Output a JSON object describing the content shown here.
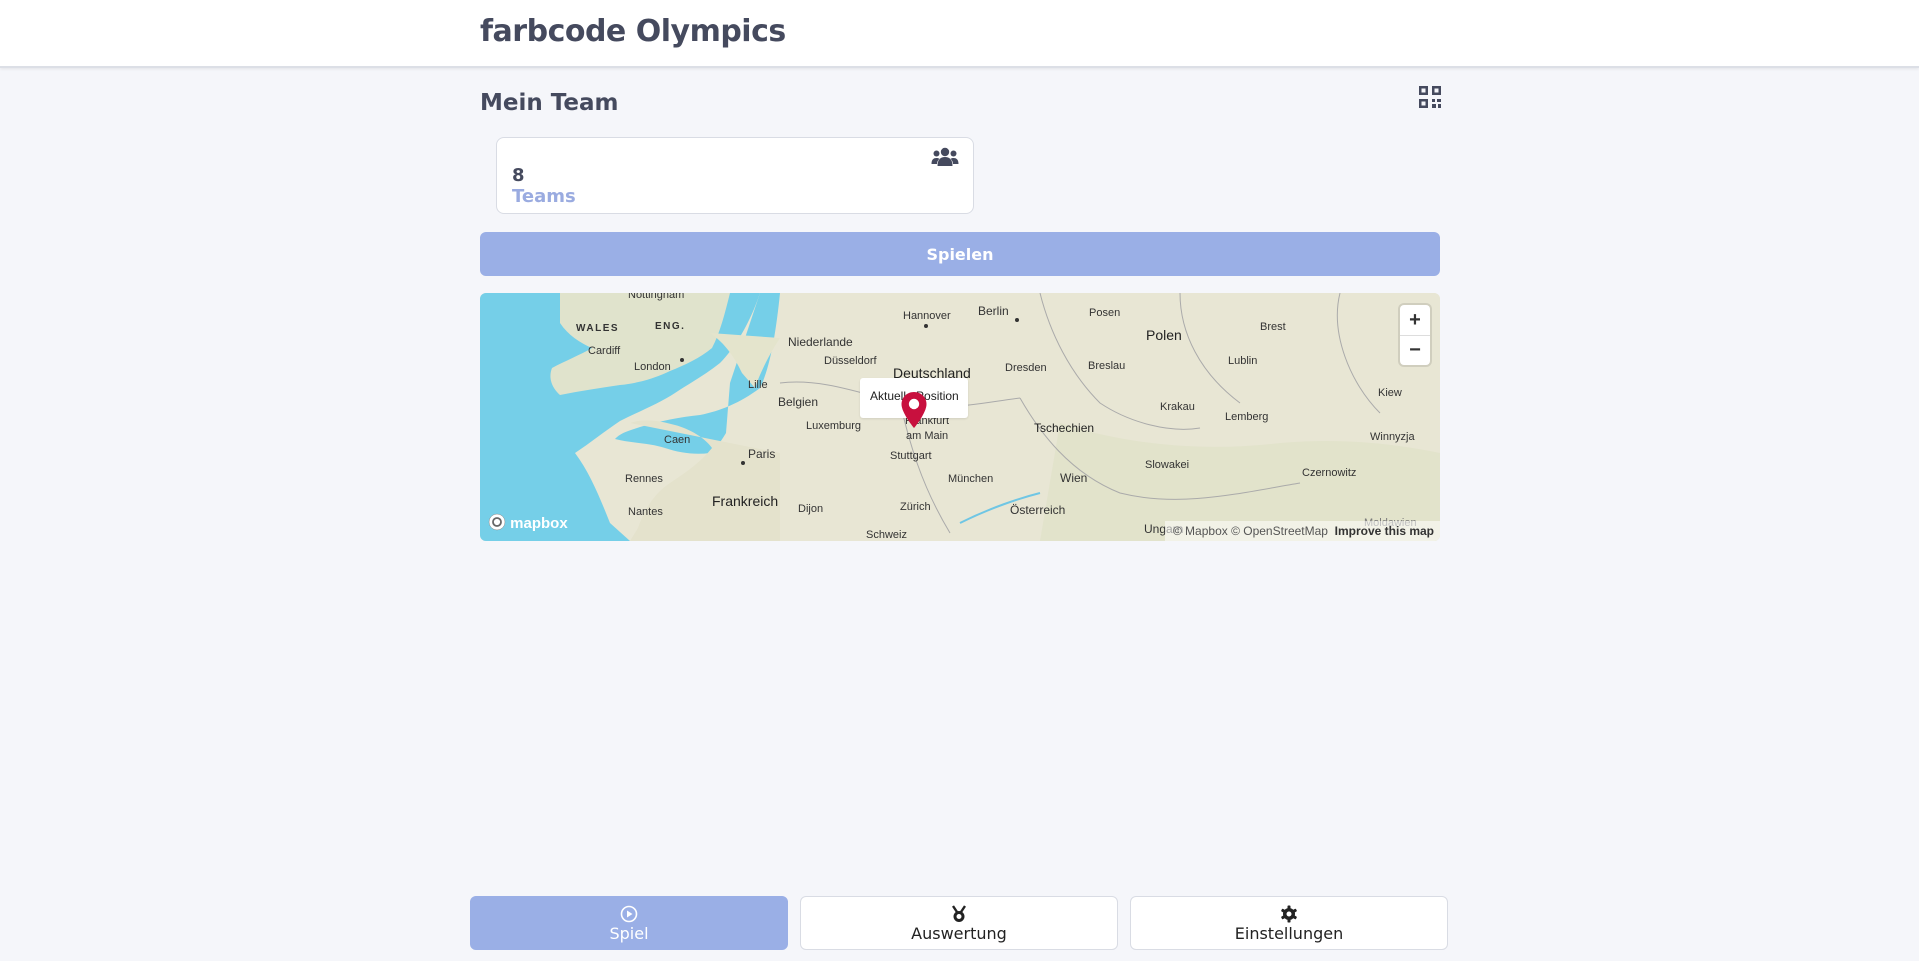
{
  "app": {
    "title": "farbcode Olympics"
  },
  "team": {
    "section_title": "Mein Team",
    "count": "8",
    "count_label": "Teams"
  },
  "actions": {
    "play_label": "Spielen"
  },
  "map": {
    "popup_text": "Aktuelle Position",
    "zoom_in": "+",
    "zoom_out": "−",
    "logo_text": "mapbox",
    "attribution": "© Mapbox © OpenStreetMap",
    "improve": "Improve this map",
    "places": {
      "nottingham": "Nottingham",
      "wales": "WALES",
      "eng": "ENG.",
      "cardiff": "Cardiff",
      "london": "London",
      "niederlande": "Niederlande",
      "duesseldorf": "Düsseldorf",
      "hannover": "Hannover",
      "berlin": "Berlin",
      "posen": "Posen",
      "polen": "Polen",
      "brest": "Brest",
      "deutschland": "Deutschland",
      "dresden": "Dresden",
      "breslau": "Breslau",
      "lublin": "Lublin",
      "lille": "Lille",
      "belgien": "Belgien",
      "luxemburg": "Luxemburg",
      "frankfurt1": "Frankfurt",
      "frankfurt2": "am Main",
      "krakau": "Krakau",
      "lemberg": "Lemberg",
      "kiew": "Kiew",
      "caen": "Caen",
      "paris": "Paris",
      "stuttgart": "Stuttgart",
      "tschechien": "Tschechien",
      "winnyzja": "Winnyzja",
      "rennes": "Rennes",
      "muenchen": "München",
      "wien": "Wien",
      "slowakei": "Slowakei",
      "czernowitz": "Czernowitz",
      "frankreich": "Frankreich",
      "nantes": "Nantes",
      "dijon": "Dijon",
      "zuerich": "Zürich",
      "oesterreich": "Österreich",
      "schweiz": "Schweiz",
      "ungarn": "Ungarn",
      "moldawien": "Moldawien"
    }
  },
  "nav": {
    "items": [
      {
        "label": "Spiel",
        "icon": "play-circle-icon",
        "active": true
      },
      {
        "label": "Auswertung",
        "icon": "medal-icon",
        "active": false
      },
      {
        "label": "Einstellungen",
        "icon": "gear-icon",
        "active": false
      }
    ]
  },
  "colors": {
    "accent": "#9aafe6",
    "marker": "#c8103e",
    "water": "#75cfe8",
    "land": "#e8e6d4"
  }
}
